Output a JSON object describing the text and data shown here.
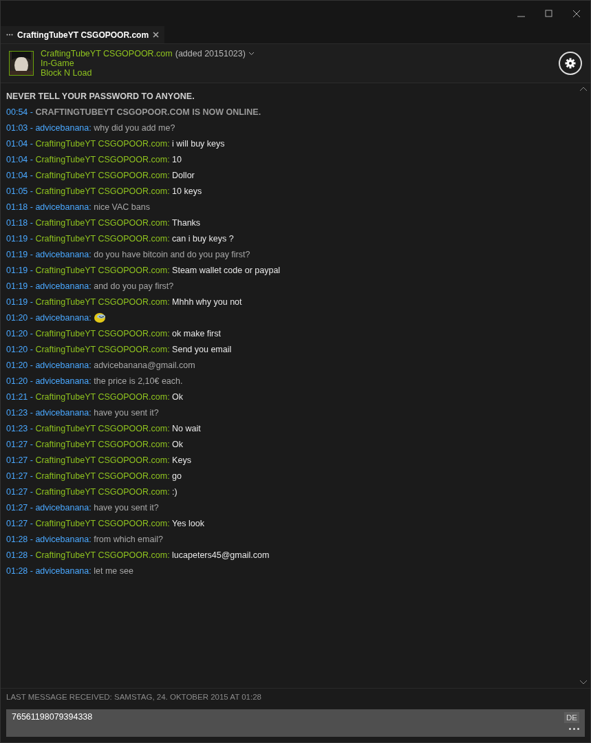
{
  "tab": {
    "label": "CraftingTubeYT CSGOPOOR.com",
    "selected": true
  },
  "friend": {
    "name": "CraftingTubeYT CSGOPOOR.com",
    "added": "(added 20151023)",
    "status": "In-Game",
    "game": "Block N Load"
  },
  "notice": "NEVER TELL YOUR PASSWORD TO ANYONE.",
  "online": {
    "time": "00:54 -",
    "text": "CRAFTINGTUBEYT CSGOPOOR.COM IS NOW ONLINE."
  },
  "messages": [
    {
      "time": "01:03 -",
      "sender": "advicebanana:",
      "kind": "self",
      "text": "why did you add me?"
    },
    {
      "time": "01:04 -",
      "sender": "CraftingTubeYT CSGOPOOR.com:",
      "kind": "friend",
      "text": "i will buy keys"
    },
    {
      "time": "01:04 -",
      "sender": "CraftingTubeYT CSGOPOOR.com:",
      "kind": "friend",
      "text": "10"
    },
    {
      "time": "01:04 -",
      "sender": "CraftingTubeYT CSGOPOOR.com:",
      "kind": "friend",
      "text": "Dollor"
    },
    {
      "time": "01:05 -",
      "sender": "CraftingTubeYT CSGOPOOR.com:",
      "kind": "friend",
      "text": "10 keys"
    },
    {
      "time": "01:18 -",
      "sender": "advicebanana:",
      "kind": "self",
      "text": "nice VAC bans"
    },
    {
      "time": "01:18 -",
      "sender": "CraftingTubeYT CSGOPOOR.com:",
      "kind": "friend",
      "text": "Thanks"
    },
    {
      "time": "01:19 -",
      "sender": "CraftingTubeYT CSGOPOOR.com:",
      "kind": "friend",
      "text": "can i buy keys ?"
    },
    {
      "time": "01:19 -",
      "sender": "advicebanana:",
      "kind": "self",
      "text": "do you have bitcoin and do you pay first?"
    },
    {
      "time": "01:19 -",
      "sender": "CraftingTubeYT CSGOPOOR.com:",
      "kind": "friend",
      "text": "Steam wallet code or paypal"
    },
    {
      "time": "01:19 -",
      "sender": "advicebanana:",
      "kind": "self",
      "text": "and do you pay first?"
    },
    {
      "time": "01:19 -",
      "sender": "CraftingTubeYT CSGOPOOR.com:",
      "kind": "friend",
      "text": "Mhhh why you not"
    },
    {
      "time": "01:20 -",
      "sender": "advicebanana:",
      "kind": "self",
      "emoticon": true
    },
    {
      "time": "01:20 -",
      "sender": "CraftingTubeYT CSGOPOOR.com:",
      "kind": "friend",
      "text": "ok make first"
    },
    {
      "time": "01:20 -",
      "sender": "CraftingTubeYT CSGOPOOR.com:",
      "kind": "friend",
      "text": "Send you email"
    },
    {
      "time": "01:20 -",
      "sender": "advicebanana:",
      "kind": "self",
      "text": "advicebanana@gmail.com"
    },
    {
      "time": "01:20 -",
      "sender": "advicebanana:",
      "kind": "self",
      "text": "the price is 2,10€ each."
    },
    {
      "time": "01:21 -",
      "sender": "CraftingTubeYT CSGOPOOR.com:",
      "kind": "friend",
      "text": "Ok"
    },
    {
      "time": "01:23 -",
      "sender": "advicebanana:",
      "kind": "self",
      "text": "have you sent it?"
    },
    {
      "time": "01:23 -",
      "sender": "CraftingTubeYT CSGOPOOR.com:",
      "kind": "friend",
      "text": "No wait"
    },
    {
      "time": "01:27 -",
      "sender": "CraftingTubeYT CSGOPOOR.com:",
      "kind": "friend",
      "text": "Ok"
    },
    {
      "time": "01:27 -",
      "sender": "CraftingTubeYT CSGOPOOR.com:",
      "kind": "friend",
      "text": "Keys"
    },
    {
      "time": "01:27 -",
      "sender": "CraftingTubeYT CSGOPOOR.com:",
      "kind": "friend",
      "text": "go"
    },
    {
      "time": "01:27 -",
      "sender": "CraftingTubeYT CSGOPOOR.com:",
      "kind": "friend",
      "text": ":)"
    },
    {
      "time": "01:27 -",
      "sender": "advicebanana:",
      "kind": "self",
      "text": "have you sent it?"
    },
    {
      "time": "01:27 -",
      "sender": "CraftingTubeYT CSGOPOOR.com:",
      "kind": "friend",
      "text": "Yes look"
    },
    {
      "time": "01:28 -",
      "sender": "advicebanana:",
      "kind": "self",
      "text": "from which email?"
    },
    {
      "time": "01:28 -",
      "sender": "CraftingTubeYT CSGOPOOR.com:",
      "kind": "friend",
      "text": "lucapeters45@gmail.com"
    },
    {
      "time": "01:28 -",
      "sender": "advicebanana:",
      "kind": "self",
      "text": "let me see"
    }
  ],
  "last_received": "LAST MESSAGE RECEIVED: SAMSTAG, 24. OKTOBER 2015 AT 01:28",
  "input": {
    "value": "76561198079394338",
    "language": "DE"
  }
}
